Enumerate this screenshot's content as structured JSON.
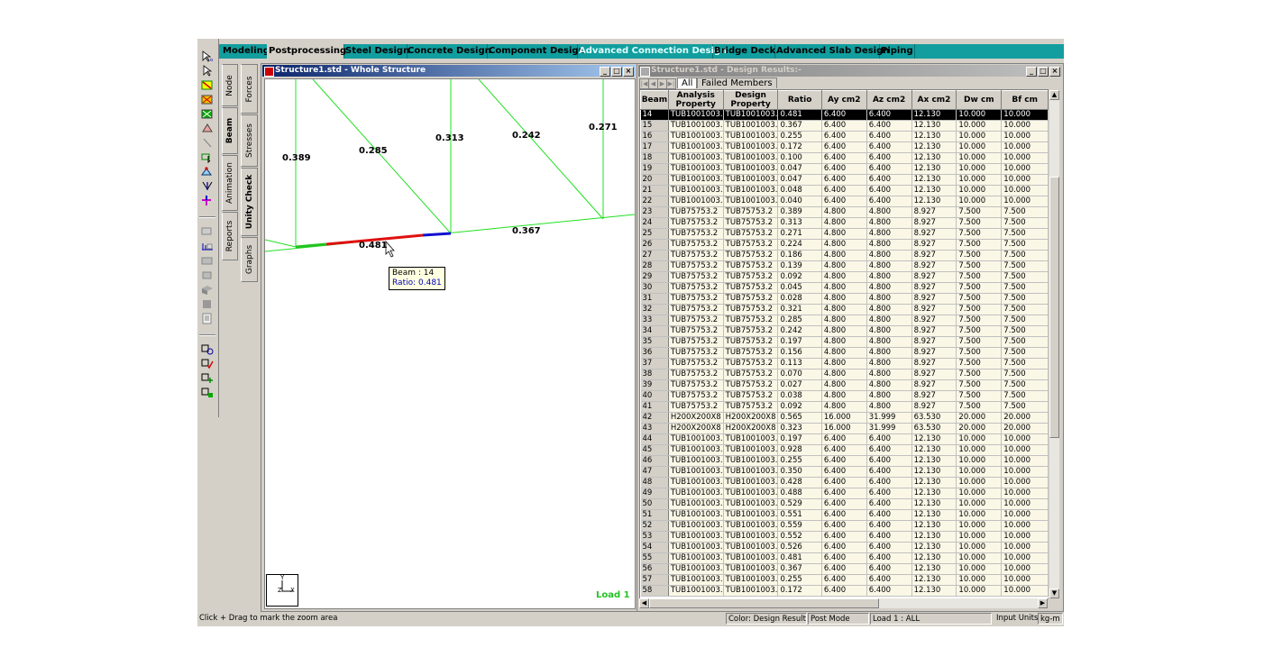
{
  "mode_tabs": [
    {
      "label": "Modeling",
      "state": "normal"
    },
    {
      "label": "Postprocessing",
      "state": "active"
    },
    {
      "label": "Steel Design",
      "state": "normal"
    },
    {
      "label": "Concrete Design",
      "state": "normal"
    },
    {
      "label": "Component Design",
      "state": "normal"
    },
    {
      "label": "Advanced Connection Design",
      "state": "cyan"
    },
    {
      "label": "Bridge Deck",
      "state": "normal"
    },
    {
      "label": "Advanced Slab Design",
      "state": "normal"
    },
    {
      "label": "Piping",
      "state": "normal"
    }
  ],
  "page_tabs_outer": {
    "node": "Node",
    "beam": "Beam",
    "animation": "Animation",
    "reports": "Reports"
  },
  "page_tabs_inner": {
    "forces": "Forces",
    "stresses": "Stresses",
    "unity_check": "Unity Check",
    "graphs": "Graphs"
  },
  "viewport": {
    "title": "Structure1.std - Whole Structure",
    "labels": {
      "m0389": "0.389",
      "m0285": "0.285",
      "m0313": "0.313",
      "m0242": "0.242",
      "m0271": "0.271",
      "m0481": "0.481",
      "m0367": "0.367"
    },
    "tooltip": {
      "beam": "Beam : 14",
      "ratio": "Ratio: 0.481"
    },
    "load_label": "Load 1",
    "axis": {
      "y": "Y",
      "z": "Z",
      "x": "X"
    },
    "colors": {
      "members": "#22e022",
      "highlight_green": "#22c322",
      "highlight_red": "#e01010",
      "highlight_blue": "#1010d0"
    }
  },
  "table_window": {
    "title": "Structure1.std - Design Results:-",
    "tabs": {
      "all": "All",
      "failed": "Failed Members"
    },
    "columns": [
      "Beam",
      "Analysis Property",
      "Design Property",
      "Ratio",
      "Ay cm2",
      "Az cm2",
      "Ax cm2",
      "Dw cm",
      "Bf cm"
    ],
    "rows": [
      [
        "14",
        "TUB1001003.",
        "TUB1001003.",
        "0.481",
        "6.400",
        "6.400",
        "12.130",
        "10.000",
        "10.000"
      ],
      [
        "15",
        "TUB1001003.",
        "TUB1001003.",
        "0.367",
        "6.400",
        "6.400",
        "12.130",
        "10.000",
        "10.000"
      ],
      [
        "16",
        "TUB1001003.",
        "TUB1001003.",
        "0.255",
        "6.400",
        "6.400",
        "12.130",
        "10.000",
        "10.000"
      ],
      [
        "17",
        "TUB1001003.",
        "TUB1001003.",
        "0.172",
        "6.400",
        "6.400",
        "12.130",
        "10.000",
        "10.000"
      ],
      [
        "18",
        "TUB1001003.",
        "TUB1001003.",
        "0.100",
        "6.400",
        "6.400",
        "12.130",
        "10.000",
        "10.000"
      ],
      [
        "19",
        "TUB1001003.",
        "TUB1001003.",
        "0.047",
        "6.400",
        "6.400",
        "12.130",
        "10.000",
        "10.000"
      ],
      [
        "20",
        "TUB1001003.",
        "TUB1001003.",
        "0.047",
        "6.400",
        "6.400",
        "12.130",
        "10.000",
        "10.000"
      ],
      [
        "21",
        "TUB1001003.",
        "TUB1001003.",
        "0.048",
        "6.400",
        "6.400",
        "12.130",
        "10.000",
        "10.000"
      ],
      [
        "22",
        "TUB1001003.",
        "TUB1001003.",
        "0.040",
        "6.400",
        "6.400",
        "12.130",
        "10.000",
        "10.000"
      ],
      [
        "23",
        "TUB75753.2",
        "TUB75753.2",
        "0.389",
        "4.800",
        "4.800",
        "8.927",
        "7.500",
        "7.500"
      ],
      [
        "24",
        "TUB75753.2",
        "TUB75753.2",
        "0.313",
        "4.800",
        "4.800",
        "8.927",
        "7.500",
        "7.500"
      ],
      [
        "25",
        "TUB75753.2",
        "TUB75753.2",
        "0.271",
        "4.800",
        "4.800",
        "8.927",
        "7.500",
        "7.500"
      ],
      [
        "26",
        "TUB75753.2",
        "TUB75753.2",
        "0.224",
        "4.800",
        "4.800",
        "8.927",
        "7.500",
        "7.500"
      ],
      [
        "27",
        "TUB75753.2",
        "TUB75753.2",
        "0.186",
        "4.800",
        "4.800",
        "8.927",
        "7.500",
        "7.500"
      ],
      [
        "28",
        "TUB75753.2",
        "TUB75753.2",
        "0.139",
        "4.800",
        "4.800",
        "8.927",
        "7.500",
        "7.500"
      ],
      [
        "29",
        "TUB75753.2",
        "TUB75753.2",
        "0.092",
        "4.800",
        "4.800",
        "8.927",
        "7.500",
        "7.500"
      ],
      [
        "30",
        "TUB75753.2",
        "TUB75753.2",
        "0.045",
        "4.800",
        "4.800",
        "8.927",
        "7.500",
        "7.500"
      ],
      [
        "31",
        "TUB75753.2",
        "TUB75753.2",
        "0.028",
        "4.800",
        "4.800",
        "8.927",
        "7.500",
        "7.500"
      ],
      [
        "32",
        "TUB75753.2",
        "TUB75753.2",
        "0.321",
        "4.800",
        "4.800",
        "8.927",
        "7.500",
        "7.500"
      ],
      [
        "33",
        "TUB75753.2",
        "TUB75753.2",
        "0.285",
        "4.800",
        "4.800",
        "8.927",
        "7.500",
        "7.500"
      ],
      [
        "34",
        "TUB75753.2",
        "TUB75753.2",
        "0.242",
        "4.800",
        "4.800",
        "8.927",
        "7.500",
        "7.500"
      ],
      [
        "35",
        "TUB75753.2",
        "TUB75753.2",
        "0.197",
        "4.800",
        "4.800",
        "8.927",
        "7.500",
        "7.500"
      ],
      [
        "36",
        "TUB75753.2",
        "TUB75753.2",
        "0.156",
        "4.800",
        "4.800",
        "8.927",
        "7.500",
        "7.500"
      ],
      [
        "37",
        "TUB75753.2",
        "TUB75753.2",
        "0.113",
        "4.800",
        "4.800",
        "8.927",
        "7.500",
        "7.500"
      ],
      [
        "38",
        "TUB75753.2",
        "TUB75753.2",
        "0.070",
        "4.800",
        "4.800",
        "8.927",
        "7.500",
        "7.500"
      ],
      [
        "39",
        "TUB75753.2",
        "TUB75753.2",
        "0.027",
        "4.800",
        "4.800",
        "8.927",
        "7.500",
        "7.500"
      ],
      [
        "40",
        "TUB75753.2",
        "TUB75753.2",
        "0.038",
        "4.800",
        "4.800",
        "8.927",
        "7.500",
        "7.500"
      ],
      [
        "41",
        "TUB75753.2",
        "TUB75753.2",
        "0.092",
        "4.800",
        "4.800",
        "8.927",
        "7.500",
        "7.500"
      ],
      [
        "42",
        "H200X200X8",
        "H200X200X8",
        "0.565",
        "16.000",
        "31.999",
        "63.530",
        "20.000",
        "20.000"
      ],
      [
        "43",
        "H200X200X8",
        "H200X200X8",
        "0.323",
        "16.000",
        "31.999",
        "63.530",
        "20.000",
        "20.000"
      ],
      [
        "44",
        "TUB1001003.",
        "TUB1001003.",
        "0.197",
        "6.400",
        "6.400",
        "12.130",
        "10.000",
        "10.000"
      ],
      [
        "45",
        "TUB1001003.",
        "TUB1001003.",
        "0.928",
        "6.400",
        "6.400",
        "12.130",
        "10.000",
        "10.000"
      ],
      [
        "46",
        "TUB1001003.",
        "TUB1001003.",
        "0.255",
        "6.400",
        "6.400",
        "12.130",
        "10.000",
        "10.000"
      ],
      [
        "47",
        "TUB1001003.",
        "TUB1001003.",
        "0.350",
        "6.400",
        "6.400",
        "12.130",
        "10.000",
        "10.000"
      ],
      [
        "48",
        "TUB1001003.",
        "TUB1001003.",
        "0.428",
        "6.400",
        "6.400",
        "12.130",
        "10.000",
        "10.000"
      ],
      [
        "49",
        "TUB1001003.",
        "TUB1001003.",
        "0.488",
        "6.400",
        "6.400",
        "12.130",
        "10.000",
        "10.000"
      ],
      [
        "50",
        "TUB1001003.",
        "TUB1001003.",
        "0.529",
        "6.400",
        "6.400",
        "12.130",
        "10.000",
        "10.000"
      ],
      [
        "51",
        "TUB1001003.",
        "TUB1001003.",
        "0.551",
        "6.400",
        "6.400",
        "12.130",
        "10.000",
        "10.000"
      ],
      [
        "52",
        "TUB1001003.",
        "TUB1001003.",
        "0.559",
        "6.400",
        "6.400",
        "12.130",
        "10.000",
        "10.000"
      ],
      [
        "53",
        "TUB1001003.",
        "TUB1001003.",
        "0.552",
        "6.400",
        "6.400",
        "12.130",
        "10.000",
        "10.000"
      ],
      [
        "54",
        "TUB1001003.",
        "TUB1001003.",
        "0.526",
        "6.400",
        "6.400",
        "12.130",
        "10.000",
        "10.000"
      ],
      [
        "55",
        "TUB1001003.",
        "TUB1001003.",
        "0.481",
        "6.400",
        "6.400",
        "12.130",
        "10.000",
        "10.000"
      ],
      [
        "56",
        "TUB1001003.",
        "TUB1001003.",
        "0.367",
        "6.400",
        "6.400",
        "12.130",
        "10.000",
        "10.000"
      ],
      [
        "57",
        "TUB1001003.",
        "TUB1001003.",
        "0.255",
        "6.400",
        "6.400",
        "12.130",
        "10.000",
        "10.000"
      ],
      [
        "58",
        "TUB1001003.",
        "TUB1001003.",
        "0.172",
        "6.400",
        "6.400",
        "12.130",
        "10.000",
        "10.000"
      ]
    ]
  },
  "status_bar": {
    "hint": "Click + Drag to mark the zoom area",
    "color": "Color: Design Results",
    "mode": "Post Mode",
    "load": "Load 1 : ALL",
    "input_units_label": "Input Units:",
    "input_units_value": "kg-m"
  }
}
